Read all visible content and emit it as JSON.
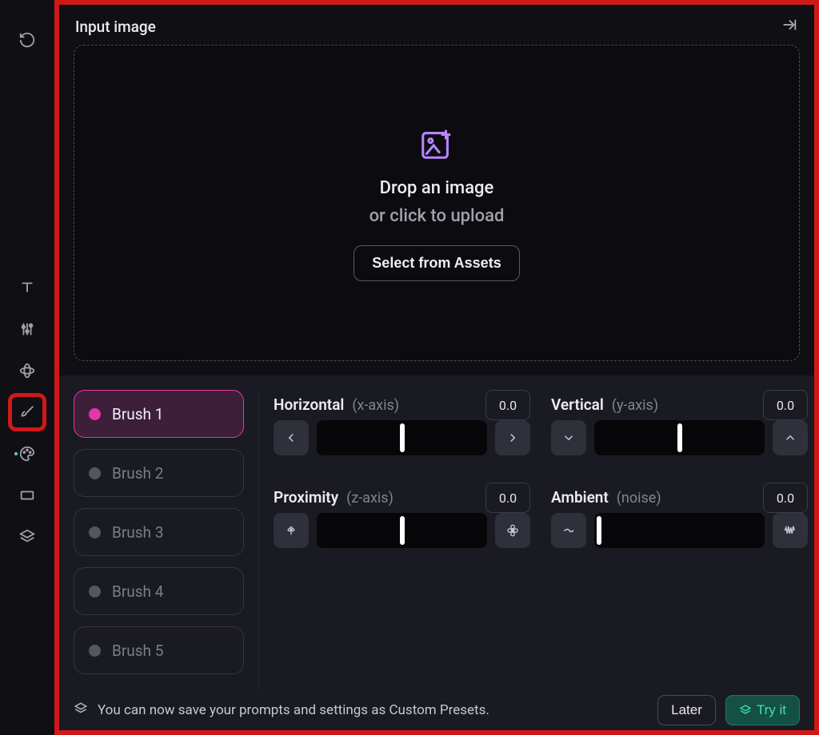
{
  "header": {
    "title": "Input image"
  },
  "dropzone": {
    "line1": "Drop an image",
    "line2": "or click to upload",
    "button": "Select from Assets"
  },
  "brushes": [
    {
      "label": "Brush 1",
      "selected": true
    },
    {
      "label": "Brush 2",
      "selected": false
    },
    {
      "label": "Brush 3",
      "selected": false
    },
    {
      "label": "Brush 4",
      "selected": false
    },
    {
      "label": "Brush 5",
      "selected": false
    }
  ],
  "controls": {
    "horizontal": {
      "label": "Horizontal",
      "sub": "(x-axis)",
      "value": "0.0",
      "thumb": "center"
    },
    "vertical": {
      "label": "Vertical",
      "sub": "(y-axis)",
      "value": "0.0",
      "thumb": "center"
    },
    "proximity": {
      "label": "Proximity",
      "sub": "(z-axis)",
      "value": "0.0",
      "thumb": "center"
    },
    "ambient": {
      "label": "Ambient",
      "sub": "(noise)",
      "value": "0.0",
      "thumb": "left"
    }
  },
  "toast": {
    "text": "You can now save your prompts and settings as Custom Presets.",
    "later": "Later",
    "try": "Try it"
  },
  "colors": {
    "accent_pink": "#e436a9",
    "accent_purple": "#b785ff",
    "accent_teal": "#3de0b3",
    "highlight_red": "#d01818"
  },
  "sidebar_icons": [
    "undo-icon",
    "text-icon",
    "sliders-icon",
    "rotate-3d-icon",
    "brush-icon",
    "palette-icon",
    "rectangle-icon",
    "layers-icon"
  ]
}
